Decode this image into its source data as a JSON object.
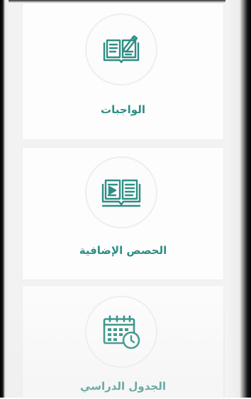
{
  "menu": {
    "items": [
      {
        "label": "الواجبات",
        "icon": "homework-book-pencil-icon"
      },
      {
        "label": "الحصص الإضافية",
        "icon": "extra-classes-book-icon"
      },
      {
        "label": "الجدول الدراسي",
        "icon": "calendar-clock-icon"
      }
    ]
  },
  "colors": {
    "accent": "#2e8e84"
  }
}
